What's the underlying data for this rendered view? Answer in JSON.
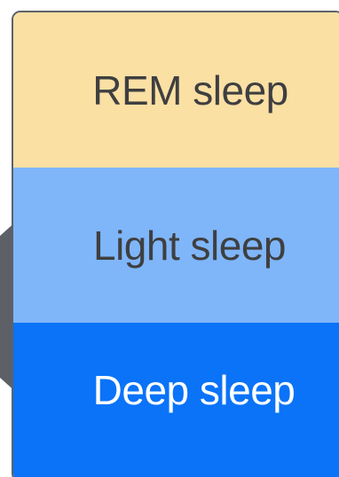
{
  "legend": {
    "stages": [
      {
        "label": "REM sleep",
        "color": "#fbe0a4"
      },
      {
        "label": "Light sleep",
        "color": "#7fb6f9"
      },
      {
        "label": "Deep sleep",
        "color": "#0a73f8"
      }
    ]
  }
}
